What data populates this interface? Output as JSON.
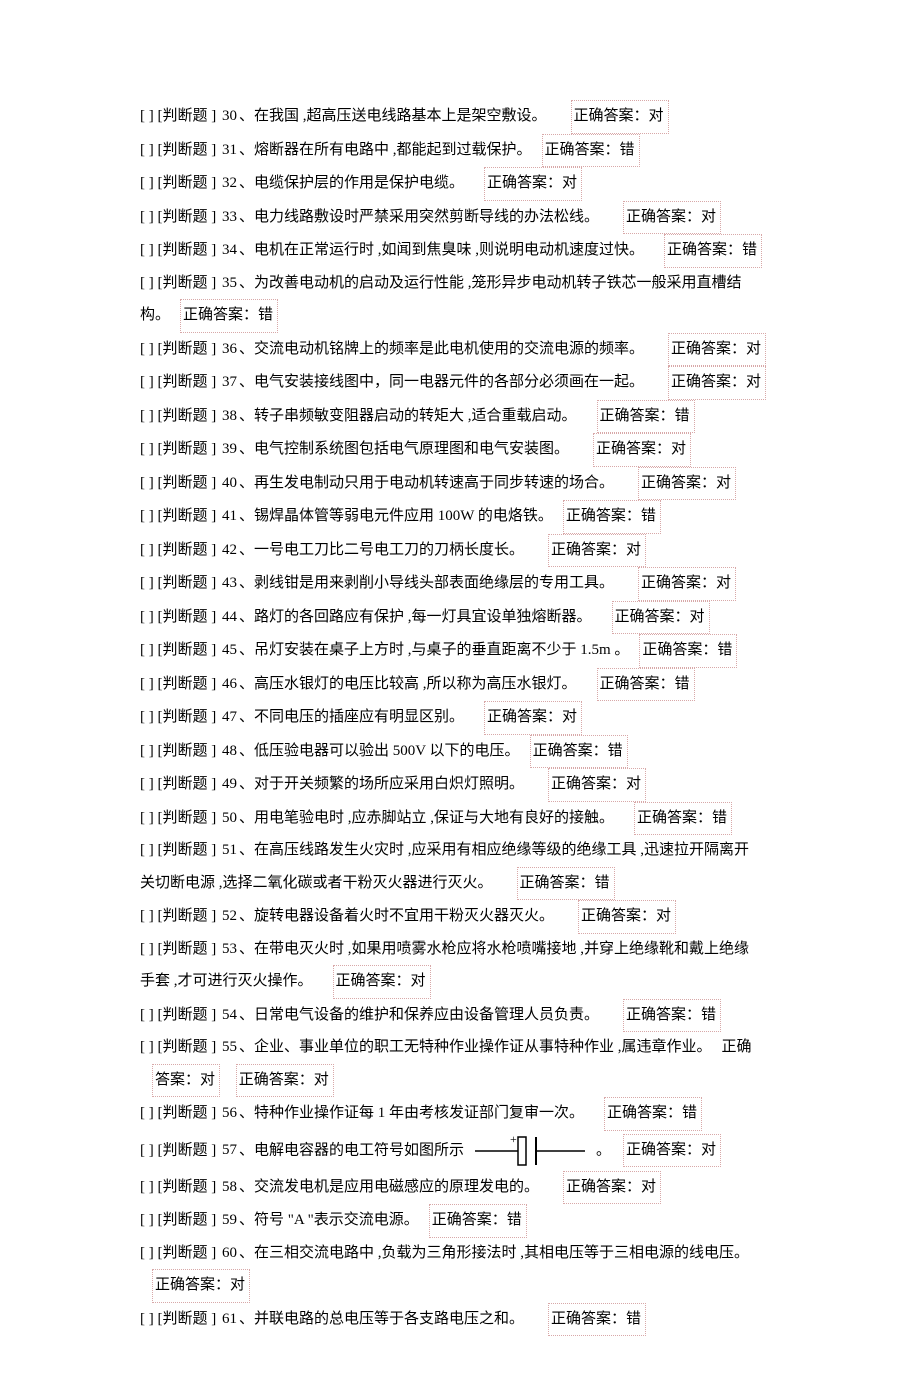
{
  "label_prefix": "[ ] [判断题 ]",
  "answer_prefix": "正确答案：",
  "questions": [
    {
      "n": "30",
      "text": "、在我国 ,超高压送电线路基本上是架空敷设。",
      "a": "对",
      "gap": "gap-l"
    },
    {
      "n": "31",
      "text": "、熔断器在所有电路中   ,都能起到过载保护。",
      "a": "错",
      "gap": "gap-s"
    },
    {
      "n": "32",
      "text": "、电缆保护层的作用是保护电缆。",
      "a": "对",
      "gap": "gap-m"
    },
    {
      "n": "33",
      "text": "、电力线路敷设时严禁采用突然剪断导线的办法松线。",
      "a": "对",
      "gap": "gap-l"
    },
    {
      "n": "34",
      "text": "、电机在正常运行时   ,如闻到焦臭味  ,则说明电动机速度过快。",
      "a": "错",
      "gap": "gap-m"
    },
    {
      "n": "35",
      "text": "、为改善电动机的启动及运行性能     ,笼形异步电动机转子铁芯一般采用直槽结",
      "a": "",
      "gap": ""
    },
    {
      "cont": true,
      "text": "构。",
      "a": "错",
      "gap": "gap-s"
    },
    {
      "n": "36",
      "text": "、交流电动机铭牌上的频率是此电机使用的交流电源的频率。",
      "a": "对",
      "gap": "gap-l"
    },
    {
      "n": "37",
      "text": "、电气安装接线图中，同一电器元件的各部分必须画在一起。",
      "a": "对",
      "gap": "gap-l"
    },
    {
      "n": "38",
      "text": "、转子串频敏变阻器启动的转矩大    ,适合重载启动。",
      "a": "错",
      "gap": "gap-m"
    },
    {
      "n": "39",
      "text": "、电气控制系统图包括电气原理图和电气安装图。",
      "a": "对",
      "gap": "gap-l"
    },
    {
      "n": "40",
      "text": "、再生发电制动只用于电动机转速高于同步转速的场合。",
      "a": "对",
      "gap": "gap-l"
    },
    {
      "n": "41",
      "text": "、锡焊晶体管等弱电元件应用    100W 的电烙铁。",
      "a": "错",
      "gap": "gap-s"
    },
    {
      "n": "42",
      "text": "、一号电工刀比二号电工刀的刀柄长度长。",
      "a": "对",
      "gap": "gap-l"
    },
    {
      "n": "43",
      "text": "、剥线钳是用来剥削小导线头部表面绝缘层的专用工具。",
      "a": "对",
      "gap": "gap-l"
    },
    {
      "n": "44",
      "text": "、路灯的各回路应有保护   ,每一灯具宜设单独熔断器。",
      "a": "对",
      "gap": "gap-m"
    },
    {
      "n": "45",
      "text": "、吊灯安装在桌子上方时   ,与桌子的垂直距离不少于    1.5m 。",
      "a": "错",
      "gap": "gap-s"
    },
    {
      "n": "46",
      "text": "、高压水银灯的电压比较高   ,所以称为高压水银灯。",
      "a": "错",
      "gap": "gap-m"
    },
    {
      "n": "47",
      "text": "、不同电压的插座应有明显区别。",
      "a": "对",
      "gap": "gap-m"
    },
    {
      "n": "48",
      "text": "、低压验电器可以验出    500V 以下的电压。",
      "a": "错",
      "gap": "gap-s"
    },
    {
      "n": "49",
      "text": "、对于开关频繁的场所应采用白炽灯照明。",
      "a": "对",
      "gap": "gap-l"
    },
    {
      "n": "50",
      "text": "、用电笔验电时  ,应赤脚站立 ,保证与大地有良好的接触。",
      "a": "错",
      "gap": "gap-m"
    },
    {
      "n": "51",
      "text": "、在高压线路发生火灾时    ,应采用有相应绝缘等级的绝缘工具    ,迅速拉开隔离开",
      "a": "",
      "gap": ""
    },
    {
      "cont": true,
      "text": "关切断电源 ,选择二氧化碳或者干粉灭火器进行灭火。",
      "a": "错",
      "gap": "gap-l"
    },
    {
      "n": "52",
      "text": "、旋转电器设备着火时不宜用干粉灭火器灭火。",
      "a": "对",
      "gap": "gap-l"
    },
    {
      "n": "53",
      "text": "、在带电灭火时  ,如果用喷雾水枪应将水枪喷嘴接地    ,并穿上绝缘靴和戴上绝缘",
      "a": "",
      "gap": ""
    },
    {
      "cont": true,
      "text": "手套 ,才可进行灭火操作。",
      "a": "对",
      "gap": "gap-m"
    },
    {
      "n": "54",
      "text": "、日常电气设备的维护和保养应由设备管理人员负责。",
      "a": "错",
      "gap": "gap-l"
    },
    {
      "n": "55",
      "text": "、企业、事业单位的职工无特种作业操作证从事特种作业    ,属违章作业。",
      "a": "",
      "gap": ""
    },
    {
      "cont": true,
      "text": "",
      "a": "对",
      "gap": "",
      "ainline": true,
      "atext": "正确"
    },
    {
      "n": "56",
      "text": "、特种作业操作证每   1 年由考核发证部门复审一次。",
      "a": "错",
      "gap": "gap-m"
    },
    {
      "n": "57",
      "text": "、电解电容器的电工符号如图所示",
      "a": "对",
      "gap": "",
      "img": true,
      "suffix": "。"
    },
    {
      "n": "58",
      "text": "、交流发电机是应用电磁感应的原理发电的。",
      "a": "对",
      "gap": "gap-l"
    },
    {
      "n": "59",
      "text": "、符号 \"A \"表示交流电源。",
      "a": "错",
      "gap": "gap-s"
    },
    {
      "n": "60",
      "text": "、在三相交流电路中   ,负载为三角形接法时    ,其相电压等于三相电源的线电压。",
      "a": "",
      "gap": ""
    },
    {
      "cont": true,
      "text": "",
      "a": "对",
      "gap": ""
    },
    {
      "n": "61",
      "text": "、并联电路的总电压等于各支路电压之和。",
      "a": "错",
      "gap": "gap-l"
    }
  ]
}
